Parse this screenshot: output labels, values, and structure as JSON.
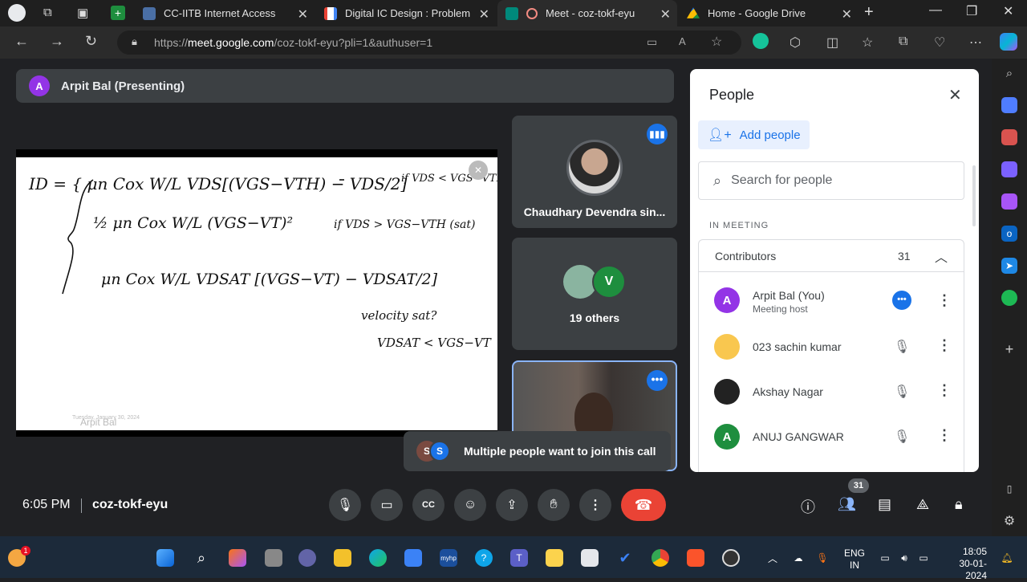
{
  "browser": {
    "tabs": [
      {
        "title": "CC-IITB Internet Access",
        "color": "#4a6fa5"
      },
      {
        "title": "Digital IC Design : Problem sol",
        "color": "#ea4335"
      },
      {
        "title": "Meet - coz-tokf-eyu",
        "color": "#00897b",
        "active": true
      },
      {
        "title": "Home - Google Drive",
        "color": "#fbbc04"
      }
    ],
    "url": {
      "prefix": "https://",
      "host": "meet.google.com",
      "path": "/coz-tokf-eyu?pli=1&authuser=1"
    }
  },
  "meet": {
    "presenter": {
      "initial": "A",
      "label": "Arpit Bal (Presenting)"
    },
    "slide": {
      "watermark_name": "Arpit Bal",
      "watermark_date": "Tuesday, January 30, 2024",
      "lines": [
        "ID = { μn Cox W/L VDS[(VGS−VTH) − VDS/2]",
        "if VDS < VGS−VTH (linear)",
        "½ μn Cox W/L (VGS−VT)²",
        "if VDS > VGS−VTH (sat)",
        "μn Cox W/L VDSAT [(VGS−VT) − VDSAT/2]",
        "velocity sat?",
        "VDSAT < VGS−VT"
      ]
    },
    "tiles": {
      "tile1_name": "Chaudhary Devendra sin...",
      "tile2_initial": "V",
      "tile2_label": "19 others"
    },
    "toast": {
      "initial1": "S",
      "initial2": "S",
      "message": "Multiple people want to join this call"
    },
    "bottom": {
      "time": "6:05 PM",
      "meeting_code": "coz-tokf-eyu",
      "people_badge": "31"
    },
    "people_panel": {
      "title": "People",
      "add_people": "Add people",
      "search_placeholder": "Search for people",
      "section": "IN MEETING",
      "group": {
        "label": "Contributors",
        "count": "31"
      },
      "members": [
        {
          "initial": "A",
          "name": "Arpit Bal (You)",
          "role": "Meeting host",
          "color": "#9334e6"
        },
        {
          "initial": "",
          "name": "023 sachin kumar",
          "role": "",
          "color": "#f9c74f"
        },
        {
          "initial": "",
          "name": "Akshay Nagar",
          "role": "",
          "color": "#222222"
        },
        {
          "initial": "A",
          "name": "ANUJ GANGWAR",
          "role": "",
          "color": "#1e8e3e"
        }
      ]
    }
  },
  "taskbar": {
    "lang_line1": "ENG",
    "lang_line2": "IN",
    "clock_time": "18:05",
    "clock_date": "30-01-2024",
    "weather_badge": "1"
  },
  "colors": {
    "accent": "#8ab4f8",
    "end_call": "#ea4335",
    "panel_blue": "#1a73e8"
  }
}
